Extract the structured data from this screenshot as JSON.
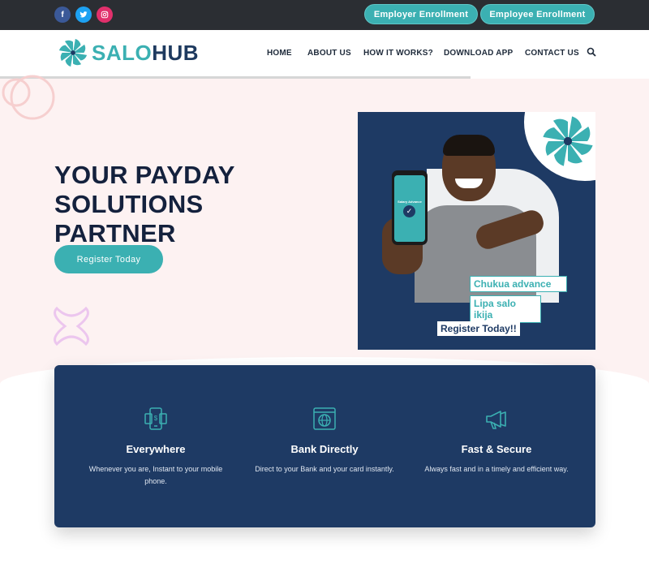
{
  "topbar": {
    "social": [
      "f",
      "t",
      "ig"
    ],
    "employer_btn": "Employer Enrollment",
    "employee_btn": "Employee Enrollment"
  },
  "brand": {
    "part1": "SALO",
    "part2": "HUB",
    "accent_color": "#3bb0b2",
    "navy_color": "#1e3a64"
  },
  "nav": {
    "items": [
      "HOME",
      "ABOUT US",
      "HOW IT WORKS?",
      "DOWNLOAD APP",
      "CONTACT US"
    ]
  },
  "hero": {
    "title_line1": "YOUR PAYDAY",
    "title_line2": "SOLUTIONS",
    "title_line3": "PARTNER",
    "cta": "Register Today"
  },
  "promo": {
    "phone_text": "Salary Advance",
    "label1": "Chukua advance",
    "label2": "Lipa salo ikija",
    "cta": "Register Today!!"
  },
  "features": [
    {
      "icon": "mobile-payment-icon",
      "title": "Everywhere",
      "desc": "Whenever you are, Instant to your mobile phone."
    },
    {
      "icon": "bank-globe-icon",
      "title": "Bank Directly",
      "desc": "Direct to your Bank and your card instantly."
    },
    {
      "icon": "megaphone-icon",
      "title": "Fast & Secure",
      "desc": "Always fast and in a timely and efficient way."
    }
  ]
}
